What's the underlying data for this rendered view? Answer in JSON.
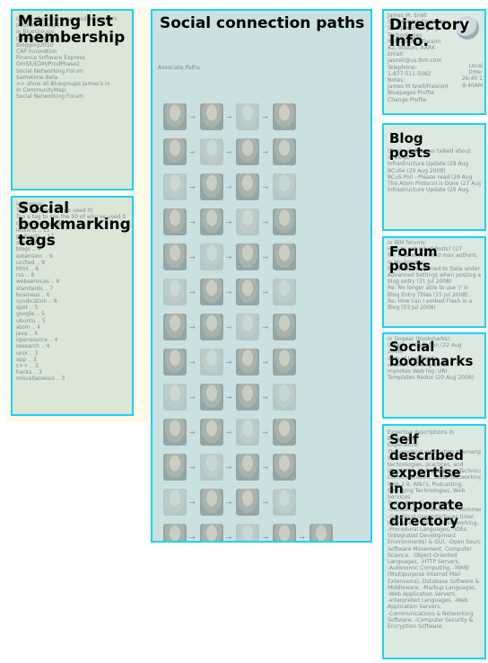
{
  "panels": {
    "mailing": {
      "title": "Mailing list membership",
      "faint_lines": [
        "Graph of people managed by James's",
        "Informal Groups --",
        "in BlueGroups:",
        "Open Activities",
        "Blogging2010",
        "CAP Innovation",
        "Finance Software Express",
        "OmSE/EDM/ProdPhase2",
        "Social Networking Forum",
        "Sametime Beta",
        ">> show all Bluegroups James's in",
        "in CommunityMap:",
        "Social Networking Forum"
      ]
    },
    "tags": {
      "title": "Social bookmarking tags",
      "faint_lines": [
        "in Dogear:",
        "Tags (# times James used it)",
        "Tap a tag to see the 50 of who've used it",
        "to tag a webpage",
        "lessons .. 11",
        "podcasts .. 11",
        "standard .. 10",
        "blogs .. 9",
        "extension .. 9",
        "unified .. 9",
        "html .. 8",
        "rss .. 8",
        "webservices .. 8",
        "standards .. 7",
        "business .. 6",
        "syndication .. 6",
        "spot .. 5",
        "google .. 5",
        "ubuntu .. 5",
        "atom .. 4",
        "java .. 4",
        "opensource .. 4",
        "research .. 4",
        "unix .. 3",
        "app .. 3",
        "c++ .. 3",
        "hacks .. 3",
        "miscellaneous .. 3"
      ]
    },
    "paths": {
      "title": "Social connection paths",
      "subtitle": "Associate Paths"
    },
    "directory": {
      "title": "Directory Info.",
      "faint_lines": [
        "James M. Snell",
        "Sr. Software Engineer,",
        "Sr. Open Emerging",
        "Technologies",
        "Raleigh, NC, Tucson",
        "AZ, Boston, AARK",
        "Email:",
        "jasnell@us.ibm.com",
        "Telephone:",
        "1-877-511-5082",
        "Notes:",
        "James M Snell/Fresno/IBM@IBMUS",
        "Bluepages Profile",
        "Change Profile"
      ],
      "local_time_label": "Local time:",
      "local_time_1": "26:40 1",
      "local_time_2": "9:40AM"
    },
    "blog": {
      "title": "Blog posts",
      "faint_lines": [
        "Chart what James talked about",
        "in Blogs:",
        "Infrastructure Update (29 Aug",
        "BCuSe (29 Aug 2008)",
        "BCuS Poll - Please read (29 Aug",
        "The Atom Protocol is Done (27 Aug",
        "Infrastructure Update (29 Aug"
      ]
    },
    "forum": {
      "title": "Forum posts",
      "faint_lines": [
        "in IBM forums:",
        "How to get rid of Posts? (27",
        "Re: Problem related max authors",
        "in My Forums:",
        "Re: What happened to Data under",
        "Advanced Settings when posting a",
        "blog entry (31 Jul 2008)",
        "Re: No longer able to use '/' in",
        "Blog Entry Titles (15 Jul 2008)",
        "Re: How can I embed Flash in a",
        "Blog (03 Jul 2008)"
      ]
    },
    "bookmarks": {
      "title": "Social bookmarks",
      "faint_lines": [
        "in Dogear (bookmarks):",
        "Ubuntu Installation (22 Aug",
        "2008)",
        "Web of Low Rights",
        "unibeck (20 Aug 2008)",
        "mynotes Web log: URI",
        "Templates Redux (20 Aug 2008)"
      ]
    },
    "expertise": {
      "title": "Self described expertise in corporate directory",
      "faint_lines": [
        "Expertise descriptions in",
        "Bluepages:",
        "Experience:",
        "The practical application of emerging",
        "Web-based Interface",
        "technologies, practices, and",
        "standards, Web practices, Technical",
        "Communication, Social Networking,",
        "Web 2.0, Wiki's, Podcasting,",
        "Emerging Technologies, Web",
        "Services",
        "Technology Experience:",
        "-Collaboration, -Electronic Commerce",
        "-Graphical User Interfaces (User",
        "Interfaces), -Wireless Networking,",
        "-Procedural Languages, -IDEs",
        "(Integrated Development",
        "Environments) & GUI, -Open Source",
        "Software Movement, Computer",
        "Science, -Object-Oriented",
        "Languages, -HTTP Servers,",
        "-Autonomic Computing, -MIME",
        "(Multipurpose Internet Mail",
        "Extensions), Database Software &",
        "Middleware, -Markup Languages,",
        "-Web Application Servers,",
        "-Interpreted Languages, -Web",
        "Application Servers,",
        "-Communications & Networking",
        "Software, -Computer Security &",
        "Encryption Software"
      ]
    }
  },
  "colors": {
    "border": "#19d3f3",
    "panel_fill": "#bed7c8",
    "background": "#fdfbe8"
  }
}
